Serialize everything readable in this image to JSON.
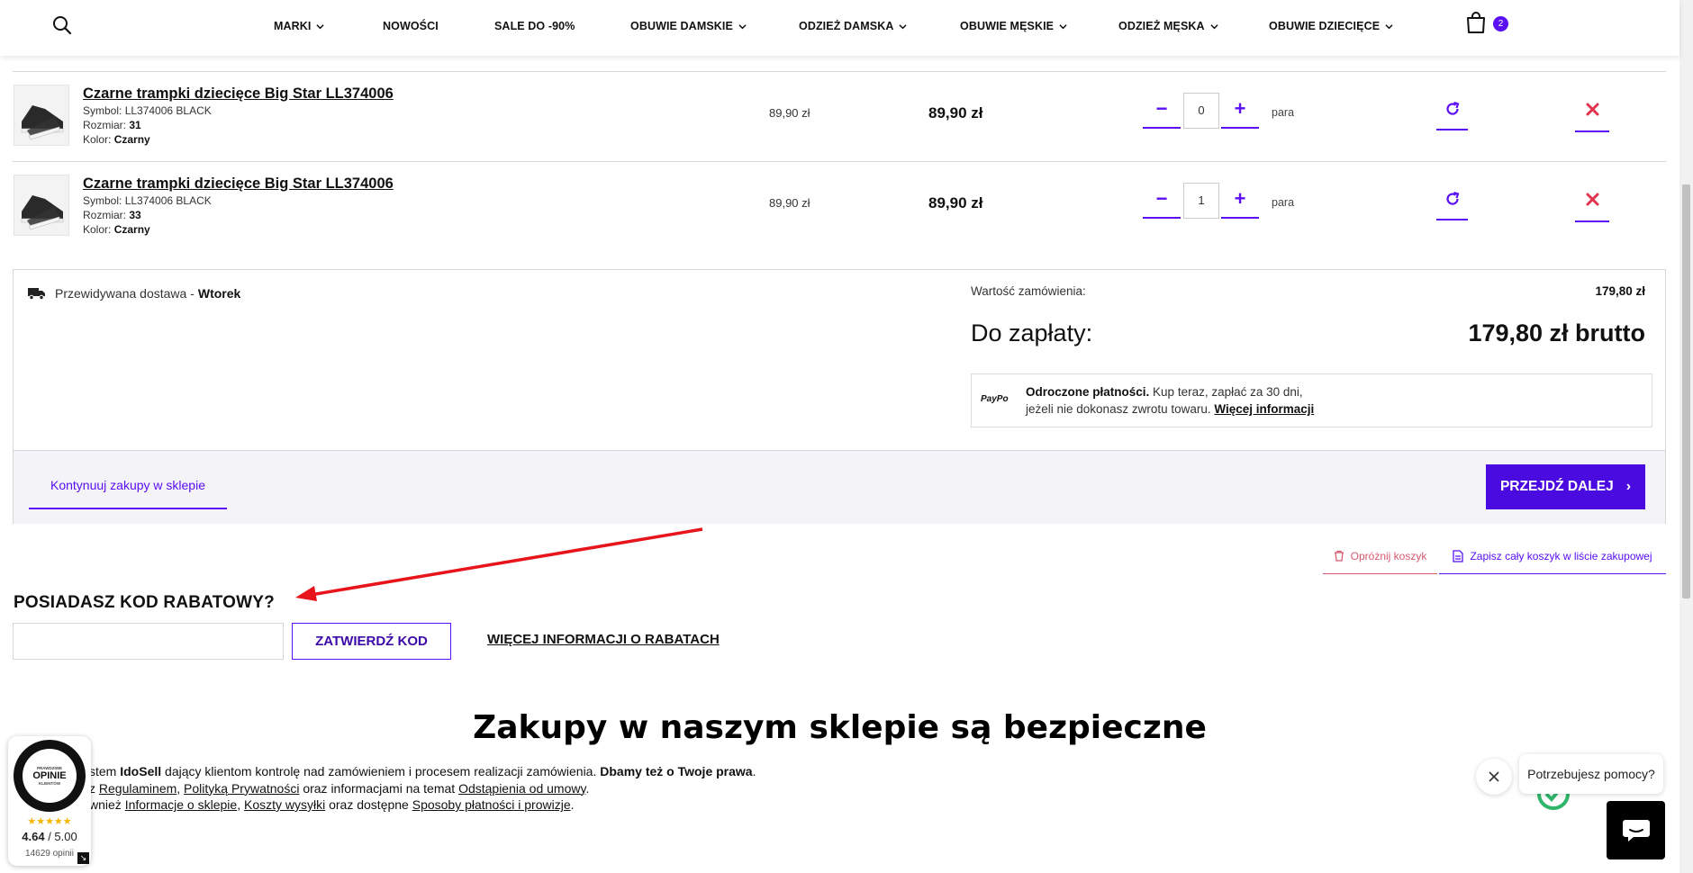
{
  "header": {
    "nav": [
      {
        "label": "MARKI",
        "dropdown": true
      },
      {
        "label": "NOWOŚCI",
        "dropdown": false
      },
      {
        "label": "SALE DO -90%",
        "dropdown": false
      },
      {
        "label": "OBUWIE DAMSKIE",
        "dropdown": true
      },
      {
        "label": "ODZIEŻ DAMSKA",
        "dropdown": true
      },
      {
        "label": "OBUWIE MĘSKIE",
        "dropdown": true
      },
      {
        "label": "ODZIEŻ MĘSKA",
        "dropdown": true
      },
      {
        "label": "OBUWIE DZIECIĘCE",
        "dropdown": true
      }
    ],
    "cart_count": "2"
  },
  "items": [
    {
      "name": "Czarne trampki dziecięce Big Star LL374006",
      "symbol_label": "Symbol: ",
      "symbol": "LL374006 BLACK",
      "size_label": "Rozmiar: ",
      "size": "31",
      "color_label": "Kolor: ",
      "color": "Czarny",
      "unit_price": "89,90 zł",
      "total_price": "89,90 zł",
      "qty": "0",
      "unit": "para"
    },
    {
      "name": "Czarne trampki dziecięce Big Star LL374006",
      "symbol_label": "Symbol: ",
      "symbol": "LL374006 BLACK",
      "size_label": "Rozmiar: ",
      "size": "33",
      "color_label": "Kolor: ",
      "color": "Czarny",
      "unit_price": "89,90 zł",
      "total_price": "89,90 zł",
      "qty": "1",
      "unit": "para"
    }
  ],
  "summary": {
    "delivery_label": "Przewidywana dostawa -",
    "delivery_day": "Wtorek",
    "order_value_label": "Wartość zamówienia:",
    "order_value": "179,80 zł",
    "to_pay_label": "Do zapłaty:",
    "to_pay": "179,80 zł brutto",
    "paypo_logo": "PayPo",
    "paypo_bold": "Odroczone płatności.",
    "paypo_line1": "Kup teraz, zapłać za 30 dni,",
    "paypo_line2": "jeżeli nie dokonasz zwrotu towaru.",
    "paypo_link": "Więcej informacji",
    "continue": "Kontynuuj zakupy w sklepie",
    "next": "PRZEJDŹ DALEJ"
  },
  "cart_actions": {
    "empty": "Opróżnij koszyk",
    "save": "Zapisz cały koszyk w liście zakupowej"
  },
  "discount": {
    "title": "POSIADASZ KOD RABATOWY?",
    "input_value": "",
    "submit": "ZATWIERDŹ KOD",
    "info": "WIĘCEJ INFORMACJI O RABATACH"
  },
  "safe": {
    "title": "Zakupy w naszym sklepie są bezpieczne",
    "line1_a": "stem ",
    "line1_b": "IdoSell",
    "line1_c": " dający klientom kontrolę nad zamówieniem i procesem realizacji zamówienia. ",
    "line1_d": "Dbamy też o Twoje prawa",
    "line1_e": ".",
    "line2_a": "z ",
    "line2_link1": "Regulaminem",
    "line2_sep": ", ",
    "line2_link2": "Polityką Prywatności",
    "line2_b": " oraz informacjami na temat ",
    "line2_link3": "Odstąpienia od umowy",
    "line2_c": ".",
    "line3_a": "wnież ",
    "line3_link1": "Informacje o sklepie",
    "line3_sep": ", ",
    "line3_link2": "Koszty wysyłki",
    "line3_b": " oraz dostępne ",
    "line3_link3": "Sposoby płatności i prowizje",
    "line3_c": "."
  },
  "opinions": {
    "small_top": "PRAWDZIWE",
    "big": "OPINIE",
    "small_bottom": "KLIENTÓW",
    "stars": "★★★★★",
    "rating": "4.64",
    "rating_sep": " / ",
    "rating_max": "5.00",
    "count": "14629 opinii",
    "stars_value": 4.64
  },
  "help": {
    "bubble": "Potrzebujesz pomocy?"
  },
  "colors": {
    "accent": "#5a0ff5",
    "primary_button": "#4a0be0",
    "remove": "#e0334d",
    "arrow": "#e8141c"
  }
}
